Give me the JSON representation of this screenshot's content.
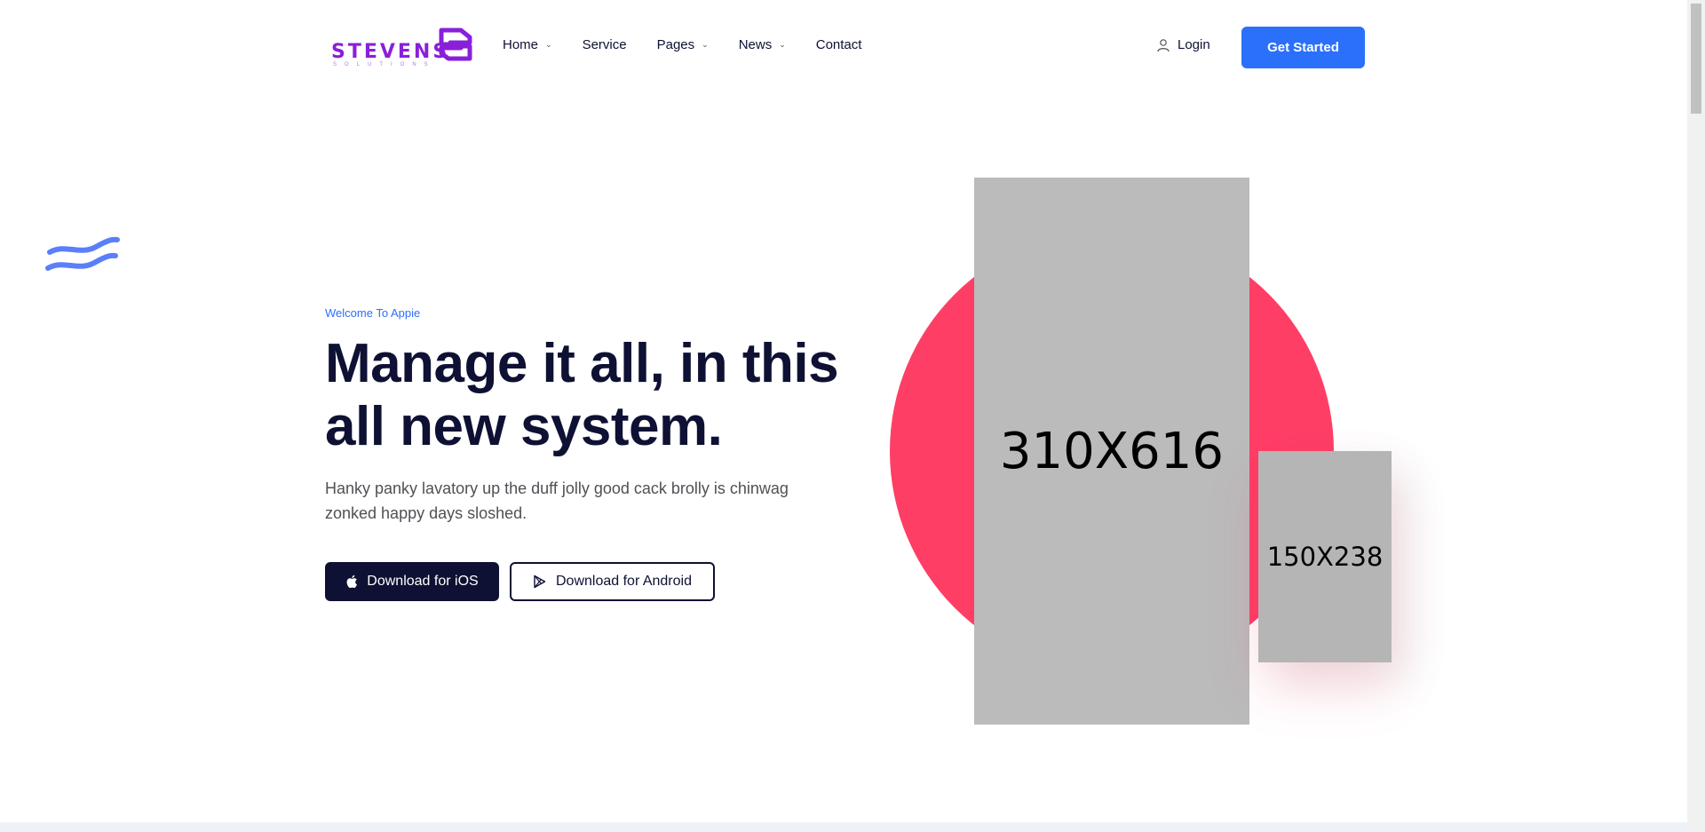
{
  "brand": {
    "name": "STEVENS",
    "tagline": "SOLUTIONS",
    "color": "#8a1fd9"
  },
  "nav": {
    "items": [
      {
        "label": "Home",
        "has_dropdown": true
      },
      {
        "label": "Service",
        "has_dropdown": false
      },
      {
        "label": "Pages",
        "has_dropdown": true
      },
      {
        "label": "News",
        "has_dropdown": true
      },
      {
        "label": "Contact",
        "has_dropdown": false
      }
    ],
    "login_label": "Login",
    "login_icon": "user-icon",
    "cta_label": "Get Started"
  },
  "hero": {
    "eyebrow": "Welcome To Appie",
    "headline": "Manage it all, in this all new system.",
    "description": "Hanky panky lavatory up the duff jolly good cack brolly is chinwag zonked happy days sloshed.",
    "buttons": {
      "ios_label": "Download for iOS",
      "ios_icon": "apple-icon",
      "android_label": "Download for Android",
      "android_icon": "google-play-icon"
    },
    "images": {
      "main_placeholder": "310X616",
      "secondary_placeholder": "150X238"
    }
  },
  "colors": {
    "accent": "#2b70fa",
    "dark": "#0e1133",
    "circle": "#ff3e66",
    "placeholder": "#bbbbbb"
  }
}
